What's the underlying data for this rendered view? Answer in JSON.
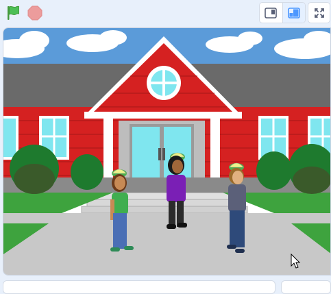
{
  "toolbar": {
    "green_flag": {
      "icon": "green-flag-icon",
      "color": "#4cbf56"
    },
    "stop": {
      "icon": "stop-sign-icon",
      "color": "#ec9c9c"
    },
    "small_stage": {
      "icon": "small-stage-icon",
      "active": false
    },
    "normal_stage": {
      "icon": "normal-stage-icon",
      "active": true
    },
    "fullscreen": {
      "icon": "fullscreen-icon"
    }
  },
  "stage": {
    "backdrop": "school-building",
    "sprites": [
      {
        "name": "student-left",
        "shirt": "#3fae4f",
        "pants": "#4a6fb5"
      },
      {
        "name": "student-center",
        "shirt": "#7a1fb5",
        "pants": "#2b2b2b"
      },
      {
        "name": "student-right",
        "shirt": "#5b6079",
        "pants": "#2e4a7a"
      }
    ],
    "cursor": "mouse-cursor-icon"
  },
  "colors": {
    "accent": "#4c97ff",
    "page_background": "#e8f0fb",
    "building_red": "#d52121",
    "sky_blue": "#5b9bd9"
  }
}
